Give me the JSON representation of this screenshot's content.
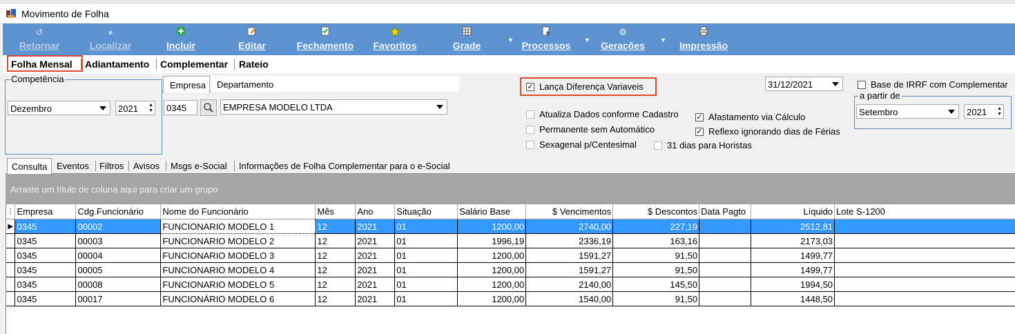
{
  "window": {
    "title": "Movimento de Folha"
  },
  "toolbar": {
    "buttons": [
      {
        "label": "Retornar",
        "icon": "return-icon"
      },
      {
        "label": "Localizar",
        "icon": "search-icon"
      },
      {
        "label": "Incluir",
        "icon": "add-icon"
      },
      {
        "label": "Editar",
        "icon": "edit-icon"
      },
      {
        "label": "Fechamento",
        "icon": "checklist-icon"
      },
      {
        "label": "Favoritos",
        "icon": "star-icon"
      },
      {
        "label": "Grade",
        "icon": "grid-icon"
      },
      {
        "label": "Processos",
        "icon": "document-gear-icon"
      },
      {
        "label": "Gerações",
        "icon": "gear-icon"
      },
      {
        "label": "Impressão",
        "icon": "printer-icon"
      }
    ]
  },
  "main_tabs": [
    "Folha Mensal",
    "Adiantamento",
    "Complementar",
    "Rateio"
  ],
  "competencia": {
    "label": "Competência",
    "month": "Dezembro",
    "year": "2021"
  },
  "empresa_tabs": [
    "Empresa",
    "Departamento"
  ],
  "empresa": {
    "code": "0345",
    "name": "EMPRESA MODELO LTDA"
  },
  "options": {
    "lanca_diferenca": "Lança Diferença Variaveis",
    "date": "31/12/2021",
    "atualiza": "Atualiza Dados conforme Cadastro",
    "permanente": "Permanente sem Automático",
    "sexagenal": "Sexagenal p/Centesimal",
    "afastamento": "Afastamento via Cálculo",
    "reflexo": "Reflexo ignorando dias de Férias",
    "horistas": "31 dias para Horistas",
    "base_irrf": "Base de IRRF com Complementar",
    "a_partir_de": "a partir de",
    "a_partir_month": "Setembro",
    "a_partir_year": "2021"
  },
  "sub_tabs": [
    "Consulta",
    "Eventos",
    "Filtros",
    "Avisos",
    "Msgs e-Social",
    "Informações de Folha Complementar para o e-Social"
  ],
  "group_hint": "Arraste um título de coluna aqui para criar um grupo",
  "grid": {
    "columns": [
      "Empresa",
      "Cdg.Funcionário",
      "Nome do Funcionário",
      "Mês",
      "Ano",
      "Situação",
      "Salário Base",
      "$ Vencimentos",
      "$ Descontos",
      "Data Pagto",
      "Líquido",
      "Lote S-1200"
    ],
    "rows": [
      [
        "0345",
        "00002",
        "FUNCIONARIO MODELO 1",
        "12",
        "2021",
        "01",
        "1200,00",
        "2740,00",
        "227,19",
        "",
        "2512,81",
        ""
      ],
      [
        "0345",
        "00003",
        "FUNCIONARIO MODELO 2",
        "12",
        "2021",
        "01",
        "1996,19",
        "2336,19",
        "163,16",
        "",
        "2173,03",
        ""
      ],
      [
        "0345",
        "00004",
        "FUNCIONARIO MODELO 3",
        "12",
        "2021",
        "01",
        "1200,00",
        "1591,27",
        "91,50",
        "",
        "1499,77",
        ""
      ],
      [
        "0345",
        "00005",
        "FUNCIONARIO MODELO 4",
        "12",
        "2021",
        "01",
        "1200,00",
        "1591,27",
        "91,50",
        "",
        "1499,77",
        ""
      ],
      [
        "0345",
        "00008",
        "FUNCIONARIO MODELO 5",
        "12",
        "2021",
        "01",
        "1200,00",
        "2140,00",
        "145,50",
        "",
        "1994,50",
        ""
      ],
      [
        "0345",
        "00017",
        "FUNCIONÁRIO MODELO 6",
        "12",
        "2021",
        "01",
        "1200,00",
        "1540,00",
        "91,50",
        "",
        "1448,50",
        ""
      ]
    ]
  }
}
